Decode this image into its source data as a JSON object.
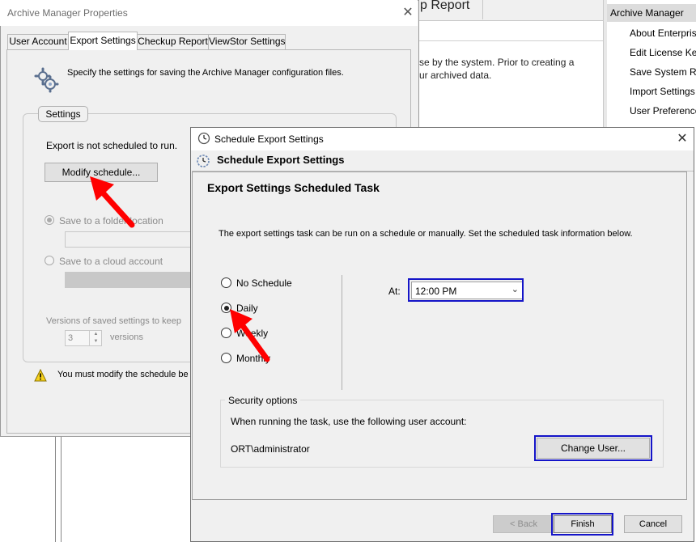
{
  "background": {
    "tab_label": "p Report",
    "text_line1": "se by the system. Prior to creating a",
    "text_line2": "ur archived data.",
    "sidebar_header": "Archive Manager",
    "sidebar_items": [
      "About Enterpris",
      "Edit License Key",
      "Save System Re",
      "Import Settings",
      "User Preference"
    ]
  },
  "properties_dialog": {
    "title": "Archive Manager Properties",
    "close_glyph": "✕",
    "tabs": [
      {
        "label": "User Account",
        "active": false
      },
      {
        "label": "Export Settings",
        "active": true
      },
      {
        "label": "Checkup Report",
        "active": false
      },
      {
        "label": "ViewStor Settings",
        "active": false
      }
    ],
    "intro": "Specify the settings for saving the Archive Manager configuration files.",
    "settings_legend": "Settings",
    "not_scheduled": "Export is not scheduled to run.",
    "modify_button": "Modify schedule...",
    "save_folder_label": "Save to a folder location",
    "save_cloud_label": "Save to a cloud account",
    "versions_label": "Versions of saved settings to keep",
    "versions_value": "3",
    "versions_suffix": "versions",
    "warning": "You must modify the schedule be",
    "gear_icon": "gears-icon",
    "warning_icon": "warning-icon"
  },
  "schedule_dialog": {
    "title": "Schedule Export Settings",
    "close_glyph": "✕",
    "header": "Schedule Export Settings",
    "task_title": "Export Settings Scheduled Task",
    "description": "The export settings task can be run on a schedule or manually. Set the scheduled task information below.",
    "options": [
      {
        "label": "No Schedule",
        "selected": false
      },
      {
        "label": "Daily",
        "selected": true
      },
      {
        "label": "Weekly",
        "selected": false
      },
      {
        "label": "Monthly",
        "selected": false
      }
    ],
    "at_label": "At:",
    "time_value": "12:00 PM",
    "security_legend": "Security options",
    "security_desc": "When running the task, use the following user account:",
    "account": "ORT\\administrator",
    "change_user_button": "Change User...",
    "back_button": "< Back",
    "finish_button": "Finish",
    "cancel_button": "Cancel",
    "clock_icon": "clock-icon",
    "header_icon": "dashed-clock-icon"
  },
  "annotations": {
    "arrow_color": "#ff0000",
    "highlight_color": "#1414c8"
  }
}
